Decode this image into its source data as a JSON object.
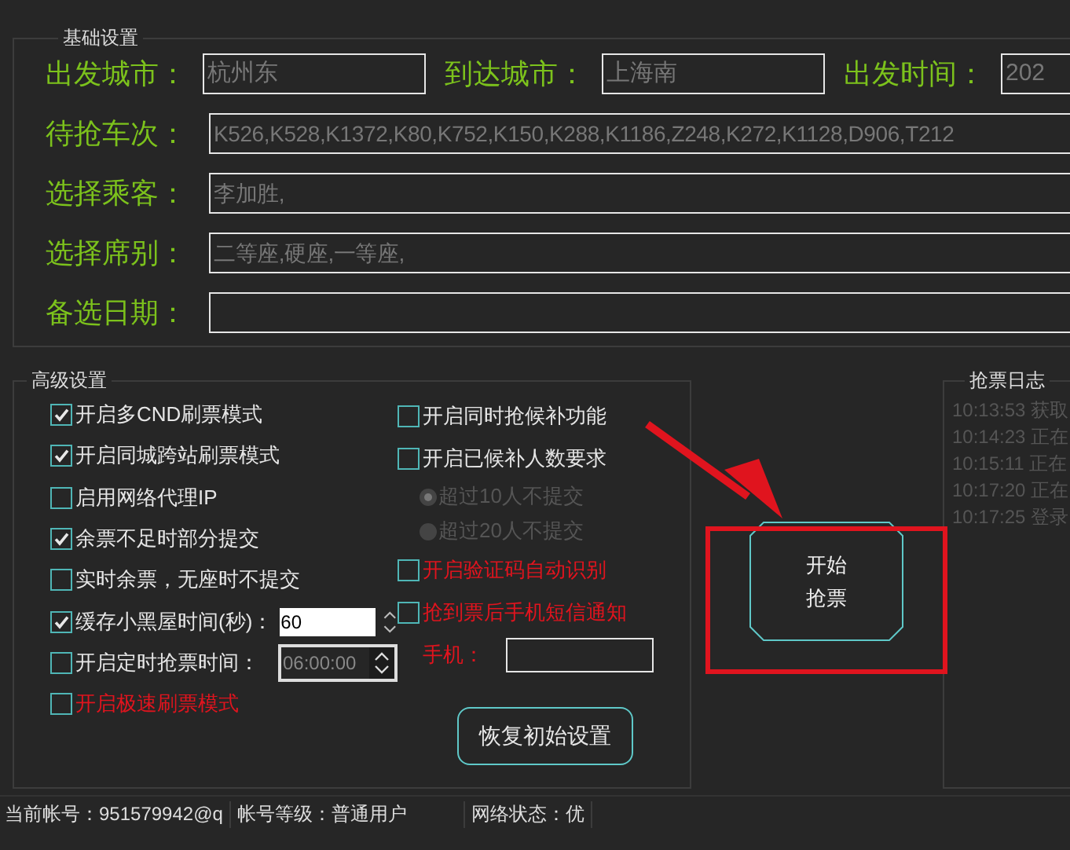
{
  "basic_settings": {
    "title": "基础设置",
    "route": [
      {
        "label": "出发城市：",
        "value": "杭州东"
      },
      {
        "label": "到达城市：",
        "value": "上海南"
      },
      {
        "label": "出发时间：",
        "value": "202"
      }
    ],
    "rows": [
      {
        "label": "待抢车次：",
        "value": "K526,K528,K1372,K80,K752,K150,K288,K1186,Z248,K272,K1128,D906,T212"
      },
      {
        "label": "选择乘客：",
        "value": "李加胜,"
      },
      {
        "label": "选择席别：",
        "value": "二等座,硬座,一等座,"
      },
      {
        "label": "备选日期："
      }
    ]
  },
  "advanced_settings": {
    "title": "高级设置",
    "left_options": [
      {
        "kind": "check",
        "label": "开启多CND刷票模式",
        "checked": true,
        "warning": false
      },
      {
        "kind": "check",
        "label": "开启同城跨站刷票模式",
        "checked": true,
        "warning": false
      },
      {
        "kind": "check",
        "label": "启用网络代理IP",
        "checked": false,
        "warning": false
      },
      {
        "kind": "check",
        "label": "余票不足时部分提交",
        "checked": true,
        "warning": false
      },
      {
        "kind": "check",
        "label": "实时余票，无座时不提交",
        "checked": false,
        "warning": false
      },
      {
        "kind": "number",
        "label": "缓存小黑屋时间(秒)：",
        "checked": true,
        "warning": false,
        "value": "60"
      },
      {
        "kind": "time",
        "label": "开启定时抢票时间：",
        "checked": false,
        "warning": false,
        "value": "06:00:00"
      },
      {
        "kind": "check",
        "label": "开启极速刷票模式",
        "checked": false,
        "warning": true
      }
    ],
    "right_options": [
      {
        "kind": "check",
        "label": "开启同时抢候补功能",
        "checked": false,
        "warning": false
      },
      {
        "kind": "check",
        "label": "开启已候补人数要求",
        "checked": false,
        "warning": false
      },
      {
        "kind": "radio",
        "label": "超过10人不提交",
        "selected": true,
        "disabled": true
      },
      {
        "kind": "radio",
        "label": "超过20人不提交",
        "selected": false,
        "disabled": true
      },
      {
        "kind": "check",
        "label": "开启验证码自动识别",
        "checked": false,
        "warning": true
      },
      {
        "kind": "check",
        "label": "抢到票后手机短信通知",
        "checked": false,
        "warning": true
      },
      {
        "kind": "phone",
        "label": "手机：",
        "warning": true
      }
    ],
    "reset_button": "恢复初始设置"
  },
  "start_button": {
    "lines": [
      "开始",
      "抢票"
    ]
  },
  "log": {
    "title": "抢票日志",
    "entries": [
      "10:13:53 获取",
      "10:14:23 正在",
      "10:15:11 正在",
      "10:17:20 正在",
      "10:17:25 登录"
    ]
  },
  "status_bar": [
    "当前帐号：951579942@q",
    "帐号等级：普通用户",
    "网络状态：优"
  ]
}
